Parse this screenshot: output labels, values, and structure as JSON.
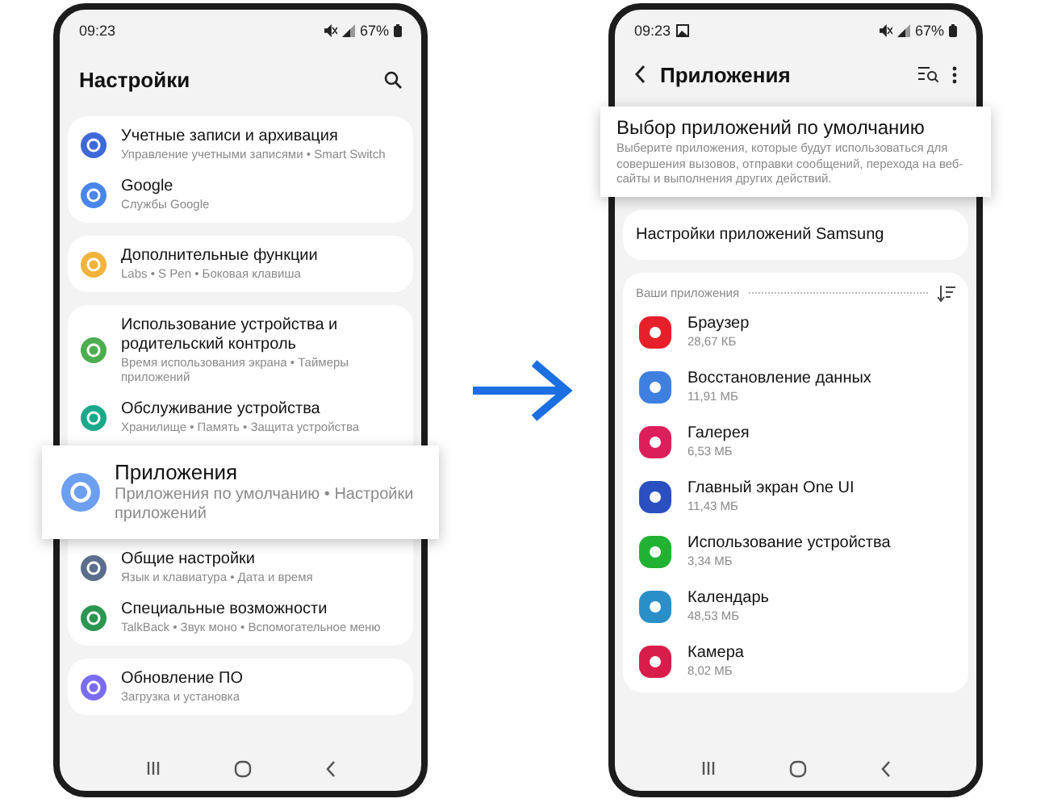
{
  "left_phone": {
    "status_bar": {
      "time": "09:23",
      "battery": "67%"
    },
    "header": {
      "title": "Настройки",
      "back": false
    },
    "groups": [
      {
        "items": [
          {
            "title": "Учетные записи и архивация",
            "subtitle": "Управление учетными записями • Smart Switch",
            "color": "#3d6ad8",
            "highlighted": false
          },
          {
            "title": "Google",
            "subtitle": "Службы Google",
            "color": "#4a86ea",
            "highlighted": false
          }
        ]
      },
      {
        "items": [
          {
            "title": "Дополнительные функции",
            "subtitle": "Labs • S Pen • Боковая клавиша",
            "color": "#f2b33d",
            "highlighted": false
          }
        ]
      },
      {
        "items": [
          {
            "title": "Использование устройства и родительский контроль",
            "subtitle": "Время использования экрана • Таймеры приложений",
            "color": "#4cae50",
            "highlighted": false
          },
          {
            "title": "Обслуживание устройства",
            "subtitle": "Хранилище • Память • Защита устройства",
            "color": "#1aa88a",
            "highlighted": false
          },
          {
            "title": "Приложения",
            "subtitle": "Приложения по умолчанию • Настройки приложений",
            "color": "#6c9ff0",
            "highlighted": true
          },
          {
            "title": "Общие настройки",
            "subtitle": "Язык и клавиатура • Дата и время",
            "color": "#5b6f8c",
            "highlighted": false
          },
          {
            "title": "Специальные возможности",
            "subtitle": "TalkBack • Звук моно • Вспомогательное меню",
            "color": "#2a9650",
            "highlighted": false
          }
        ]
      },
      {
        "items": [
          {
            "title": "Обновление ПО",
            "subtitle": "Загрузка и установка",
            "color": "#7a6cf0",
            "highlighted": false
          }
        ]
      }
    ]
  },
  "right_phone": {
    "status_bar": {
      "time": "09:23",
      "battery": "67%",
      "notification_icon": true
    },
    "header": {
      "title": "Приложения",
      "back": true
    },
    "default_apps": {
      "title": "Выбор приложений по умолчанию",
      "description": "Выберите приложения, которые будут использоваться для совершения вызовов, отправки сообщений, перехода на веб-сайты и выполнения других действий.",
      "highlighted": true
    },
    "samsung_settings": "Настройки приложений Samsung",
    "section_label": "Ваши приложения",
    "apps": [
      {
        "name": "Браузер",
        "size": "28,67 КБ",
        "color": "#e5202a"
      },
      {
        "name": "Восстановление данных",
        "size": "11,91 МБ",
        "color": "#3f7fe0"
      },
      {
        "name": "Галерея",
        "size": "6,53 МБ",
        "color": "#dc1f5a"
      },
      {
        "name": "Главный экран One UI",
        "size": "11,43 МБ",
        "color": "#2a4fc0"
      },
      {
        "name": "Использование устройства",
        "size": "3,34 МБ",
        "color": "#22b233"
      },
      {
        "name": "Календарь",
        "size": "48,53 МБ",
        "color": "#2a8fc7"
      },
      {
        "name": "Камера",
        "size": "8,02 МБ",
        "color": "#d81d4a"
      }
    ]
  }
}
